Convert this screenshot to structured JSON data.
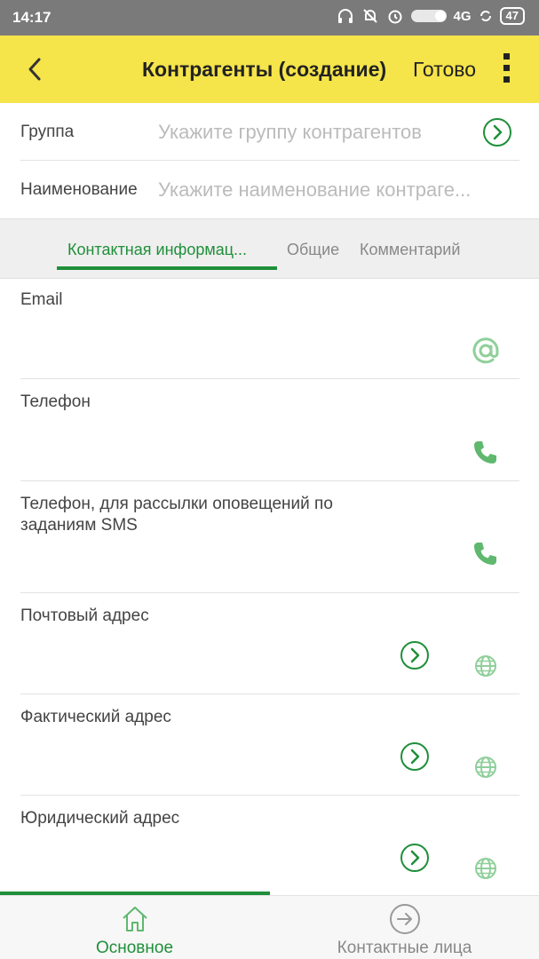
{
  "status_bar": {
    "time": "14:17",
    "network": "4G",
    "battery": "47"
  },
  "app_bar": {
    "title": "Контрагенты (создание)",
    "done_label": "Готово"
  },
  "fields": {
    "group": {
      "label": "Группа",
      "placeholder": "Укажите группу контрагентов"
    },
    "name": {
      "label": "Наименование",
      "placeholder": "Укажите наименование контраге..."
    }
  },
  "tabs": [
    {
      "label": "Контактная информац...",
      "active": true
    },
    {
      "label": "Общие",
      "active": false
    },
    {
      "label": "Комментарий",
      "active": false
    }
  ],
  "contact_sections": [
    {
      "label": "Email",
      "icon": "at-icon"
    },
    {
      "label": "Телефон",
      "icon": "phone-icon"
    },
    {
      "label": "Телефон, для рассылки оповещений по заданиям SMS",
      "icon": "phone-icon"
    },
    {
      "label": "Почтовый адрес",
      "icon": "globe-icon"
    },
    {
      "label": "Фактический адрес",
      "icon": "globe-icon"
    },
    {
      "label": "Юридический адрес",
      "icon": "globe-icon"
    }
  ],
  "bottom_nav": [
    {
      "label": "Основное",
      "icon": "home-icon",
      "active": true
    },
    {
      "label": "Контактные лица",
      "icon": "arrow-right-circle-icon",
      "active": false
    }
  ],
  "colors": {
    "accent_green": "#1f8f3a",
    "app_bar_yellow": "#f5e44a",
    "icon_light_green": "#8fcf9a"
  }
}
